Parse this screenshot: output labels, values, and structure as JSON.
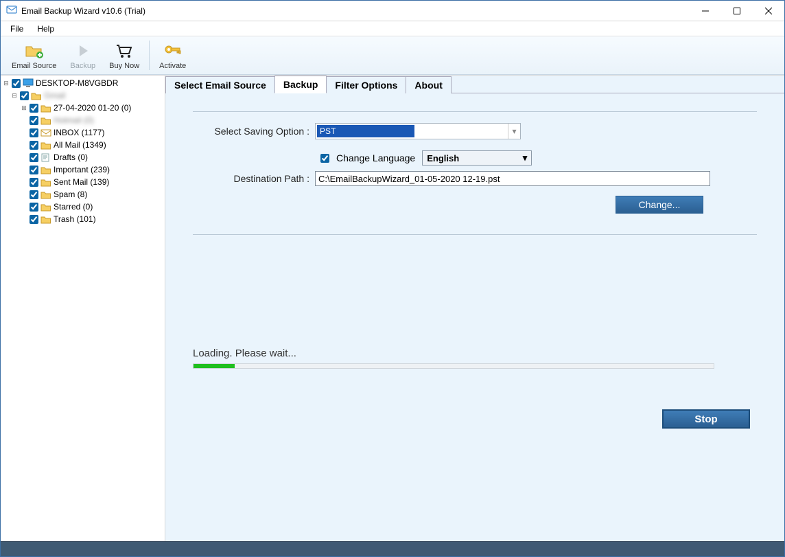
{
  "window": {
    "title": "Email Backup Wizard v10.6 (Trial)"
  },
  "menu": {
    "file": "File",
    "help": "Help"
  },
  "toolbar": {
    "email_source": "Email Source",
    "backup": "Backup",
    "buy_now": "Buy Now",
    "activate": "Activate"
  },
  "tree": {
    "root": "DESKTOP-M8VGBDR",
    "account": "Gmail",
    "folders": [
      {
        "label": "27-04-2020 01-20 (0)"
      },
      {
        "label": "Hotmail (0)",
        "blur": true
      },
      {
        "label": "INBOX (1177)"
      },
      {
        "label": "All Mail (1349)"
      },
      {
        "label": "Drafts (0)"
      },
      {
        "label": "Important (239)"
      },
      {
        "label": "Sent Mail (139)"
      },
      {
        "label": "Spam (8)"
      },
      {
        "label": "Starred (0)"
      },
      {
        "label": "Trash (101)"
      }
    ]
  },
  "tabs": {
    "select_source": "Select Email Source",
    "backup": "Backup",
    "filter": "Filter Options",
    "about": "About"
  },
  "backup": {
    "saving_option_label": "Select Saving Option  :",
    "saving_option_value": "PST",
    "change_language_label": "Change Language",
    "language_value": "English",
    "destination_label": "Destination Path  :",
    "destination_value": "C:\\EmailBackupWizard_01-05-2020 12-19.pst",
    "change_button": "Change...",
    "loading_text": "Loading. Please wait...",
    "stop_button": "Stop"
  }
}
